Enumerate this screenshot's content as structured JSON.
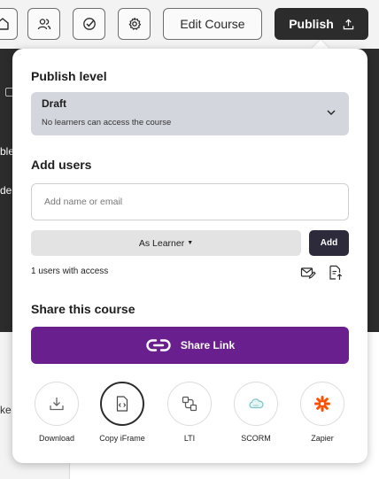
{
  "background": {
    "fragment_1": "ble,",
    "fragment_2": "de",
    "fragment_3": "ke"
  },
  "toolbar": {
    "edit_course_label": "Edit Course",
    "publish_label": "Publish"
  },
  "publish_panel": {
    "publish_level_title": "Publish level",
    "level_value": "Draft",
    "level_description": "No learners can access the course",
    "add_users_title": "Add users",
    "add_user_placeholder": "Add name or email",
    "role_label": "As Learner",
    "add_button_label": "Add",
    "users_with_access": "1 users with access",
    "share_title": "Share this course",
    "share_link_label": "Share Link",
    "integrations": [
      {
        "label": "Download",
        "icon": "download-icon"
      },
      {
        "label": "Copy iFrame",
        "icon": "code-file-icon"
      },
      {
        "label": "LTI",
        "icon": "lti-icon"
      },
      {
        "label": "SCORM",
        "icon": "scorm-cloud-icon"
      },
      {
        "label": "Zapier",
        "icon": "zapier-icon"
      }
    ]
  },
  "colors": {
    "dark_bg": "#2c2c2c",
    "share_purple": "#6a1f8f",
    "add_button": "#2d2a3b",
    "zapier_orange": "#ff4f00",
    "scorm_teal": "#7fc1c5"
  }
}
